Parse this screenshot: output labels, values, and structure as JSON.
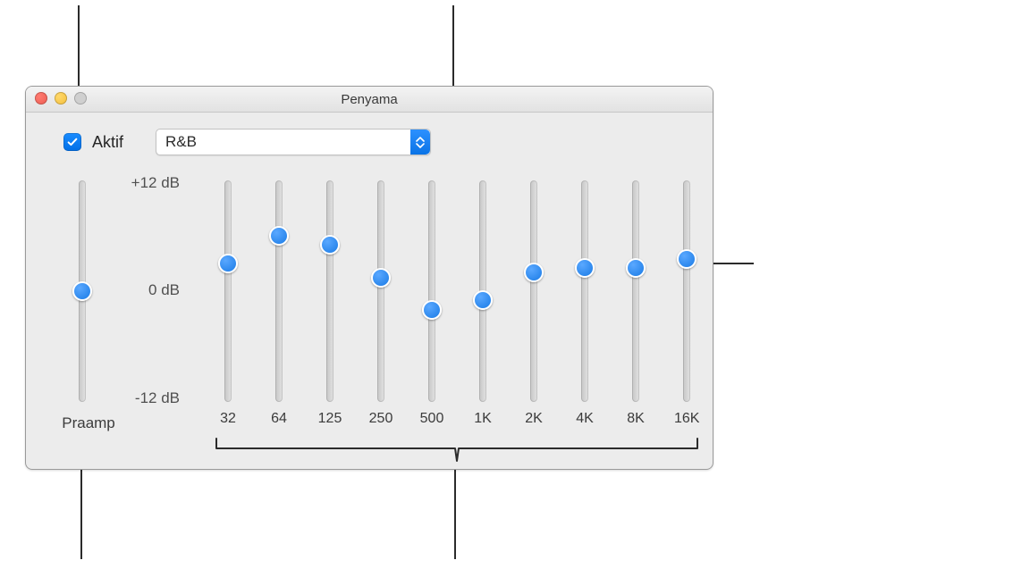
{
  "window": {
    "title": "Penyama"
  },
  "controls": {
    "enabled_label": "Aktif",
    "enabled_checked": true,
    "preset_value": "R&B"
  },
  "db_labels": {
    "max": "+12 dB",
    "mid": "0 dB",
    "min": "-12 dB"
  },
  "preamp": {
    "label": "Praamp",
    "value_db": 0
  },
  "range": {
    "min_db": -12,
    "max_db": 12
  },
  "bands": [
    {
      "freq": "32",
      "value_db": 3.0
    },
    {
      "freq": "64",
      "value_db": 6.0
    },
    {
      "freq": "125",
      "value_db": 5.0
    },
    {
      "freq": "250",
      "value_db": 1.5
    },
    {
      "freq": "500",
      "value_db": -2.0
    },
    {
      "freq": "1K",
      "value_db": -1.0
    },
    {
      "freq": "2K",
      "value_db": 2.0
    },
    {
      "freq": "4K",
      "value_db": 2.5
    },
    {
      "freq": "8K",
      "value_db": 2.5
    },
    {
      "freq": "16K",
      "value_db": 3.5
    }
  ]
}
